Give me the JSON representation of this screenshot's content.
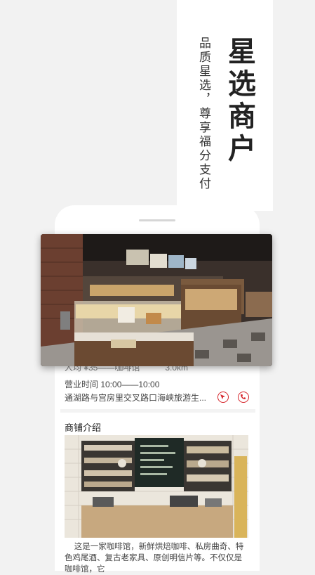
{
  "banner": {
    "title": "星选商户",
    "subtitle": "品质星选，尊享福分支付"
  },
  "shop": {
    "partial_info": "人均 ¥35——咖啡馆　　　3.0km",
    "hours": "营业时间 10:00——10:00",
    "address": "通湖路与宫房里交叉路口海峡旅游生...",
    "actions": [
      {
        "icon": "navigate-icon"
      },
      {
        "icon": "phone-icon"
      }
    ]
  },
  "intro": {
    "title": "商铺介绍",
    "description": "这是一家咖啡馆，新鲜烘焙咖啡、私房曲奇、特色鸡尾酒、复古老家具、原创明信片等。不仅仅是咖啡馆，它"
  },
  "colors": {
    "accent": "#d6252b",
    "background": "#f2f2f2"
  }
}
